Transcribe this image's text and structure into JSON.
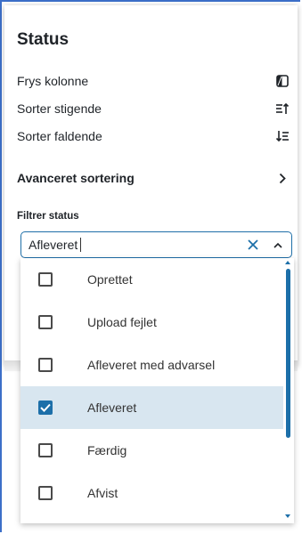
{
  "panel": {
    "title": "Status",
    "menu": [
      {
        "label": "Frys kolonne",
        "icon": "freeze-column-icon"
      },
      {
        "label": "Sorter stigende",
        "icon": "sort-ascending-icon"
      },
      {
        "label": "Sorter faldende",
        "icon": "sort-descending-icon"
      }
    ],
    "advanced_sort_label": "Avanceret sortering",
    "filter_label": "Filtrer status",
    "filter_value": "Afleveret"
  },
  "dropdown": {
    "options": [
      {
        "label": "Oprettet",
        "checked": false
      },
      {
        "label": "Upload fejlet",
        "checked": false
      },
      {
        "label": "Afleveret med advarsel",
        "checked": false
      },
      {
        "label": "Afleveret",
        "checked": true
      },
      {
        "label": "Færdig",
        "checked": false
      },
      {
        "label": "Afvist",
        "checked": false
      }
    ]
  },
  "colors": {
    "accent": "#1c6fa9",
    "selected_row": "#d8e6f0",
    "window_border": "#3c6fc8"
  }
}
